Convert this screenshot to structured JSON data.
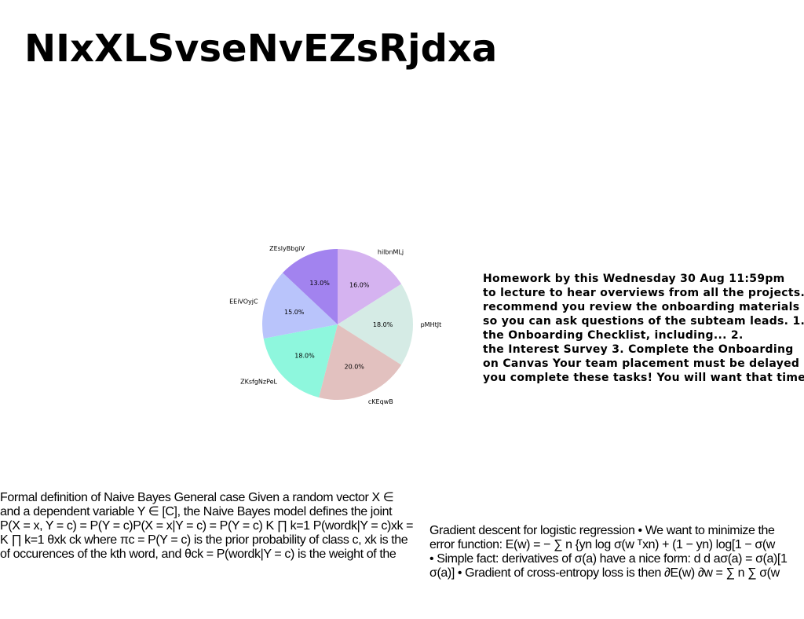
{
  "page": {
    "title": "NIxXLSvseNvEZsRjdxa"
  },
  "chart_data": {
    "type": "pie",
    "slices": [
      {
        "label": "hilbnMLj",
        "value": 16.0,
        "pct_label": "16.0%",
        "color": "#d5b3f0"
      },
      {
        "label": "pMHtJt",
        "value": 18.0,
        "pct_label": "18.0%",
        "color": "#d5ebe5"
      },
      {
        "label": "cKEqwB",
        "value": 20.0,
        "pct_label": "20.0%",
        "color": "#e2c1bf"
      },
      {
        "label": "ZKsfgNzPeL",
        "value": 18.0,
        "pct_label": "18.0%",
        "color": "#8ef7dd"
      },
      {
        "label": "EEiVOyjC",
        "value": 15.0,
        "pct_label": "15.0%",
        "color": "#b9c4fb"
      },
      {
        "label": "ZEslyBbgiV",
        "value": 13.0,
        "pct_label": "13.0%",
        "color": "#a283ef"
      }
    ],
    "start_angle_deg": 90,
    "direction": "clockwise"
  },
  "note_lines": [
    "Homework by this Wednesday 30 Aug 11:59pm",
    "to lecture to hear overviews from all the projects.",
    "recommend you review the onboarding materials",
    "so you can ask questions of the subteam leads. 1.",
    "the Onboarding Checklist, including... 2.",
    "the Interest Survey 3. Complete the Onboarding",
    "on Canvas Your team placement must be delayed",
    "you complete these tasks! You will want that time"
  ],
  "naive_bayes_lines": [
    "Formal definition of Naive Bayes General case Given a random vector X ∈",
    "and a dependent variable Y ∈ [C], the Naive Bayes model defines the joint",
    "P(X = x, Y = c) = P(Y = c)P(X = x|Y = c) = P(Y = c) K ∏ k=1 P(wordk|Y = c)xk =",
    "K ∏ k=1 θxk ck where πc = P(Y = c) is the prior probability of class c, xk is the",
    "of occurences of the kth word, and θck = P(wordk|Y = c) is the weight of the"
  ],
  "gradient_lines": [
    "Gradient descent for logistic regression • We want to minimize the",
    "error function: E(w) = − ∑ n {yn log σ(w ᵀxn) + (1 − yn) log[1 − σ(w",
    "• Simple fact: derivatives of σ(a) have a nice form: d d aσ(a) = σ(a)[1",
    "σ(a)] • Gradient of cross-entropy loss is then ∂E(w) ∂w = ∑ n ∑ σ(w"
  ]
}
